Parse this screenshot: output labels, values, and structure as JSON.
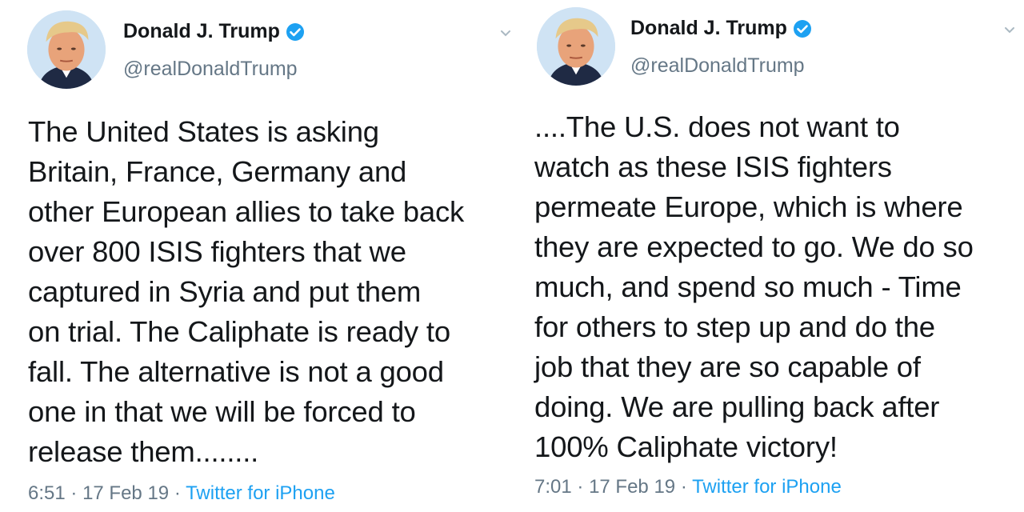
{
  "tweets": [
    {
      "author": {
        "name": "Donald J. Trump",
        "handle": "@realDonaldTrump",
        "verified": true
      },
      "text": "The United States is asking\nBritain, France, Germany and\nother European allies to take back\nover 800 ISIS fighters that we\ncaptured in Syria and put them\non trial. The Caliphate is ready to\nfall. The alternative is not a good\none in that we will be forced to\nrelease them........",
      "time": "6:51",
      "separator": "·",
      "date": "17 Feb 19",
      "source": "Twitter for iPhone"
    },
    {
      "author": {
        "name": "Donald J. Trump",
        "handle": "@realDonaldTrump",
        "verified": true
      },
      "text": "....The U.S. does not want to\nwatch as these ISIS fighters\npermeate Europe, which is where\nthey are expected to go. We do so\nmuch, and spend so much - Time\nfor others to step up and do the\njob that they are so capable of\ndoing. We are pulling back after\n100% Caliphate victory!",
      "time": "7:01",
      "separator": "·",
      "date": "17 Feb 19",
      "source": "Twitter for iPhone"
    }
  ],
  "colors": {
    "text": "#14171a",
    "secondary": "#657786",
    "link": "#1da1f2",
    "verified": "#1da1f2"
  },
  "icons": {
    "verified": "verified-badge-icon",
    "menu": "chevron-down-icon"
  }
}
